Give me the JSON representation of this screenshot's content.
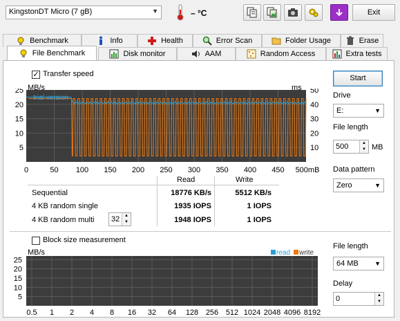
{
  "toolbar": {
    "drive": "KingstonDT Micro (7 gB)",
    "temperature": "– °C",
    "exit_label": "Exit",
    "icons": [
      "copy-text-icon",
      "copy-image-icon",
      "camera-icon",
      "options-gear-icon",
      "save-down-icon"
    ]
  },
  "tabs_top": [
    "Benchmark",
    "Info",
    "Health",
    "Error Scan",
    "Folder Usage",
    "Erase"
  ],
  "tabs_bottom": [
    "File Benchmark",
    "Disk monitor",
    "AAM",
    "Random Access",
    "Extra tests"
  ],
  "transfer": {
    "checkbox_label": "Transfer speed",
    "checked": true,
    "left_unit": "MB/s",
    "right_unit": "ms",
    "watermark": "trial version",
    "y_left": [
      "25",
      "20",
      "15",
      "10",
      "5"
    ],
    "y_right": [
      "50",
      "40",
      "30",
      "20",
      "10"
    ],
    "x_ticks": [
      "0",
      "50",
      "100",
      "150",
      "200",
      "250",
      "300",
      "350",
      "400",
      "450",
      "500mB"
    ]
  },
  "results": {
    "col_read": "Read",
    "col_write": "Write",
    "rows": [
      {
        "label": "Sequential",
        "read": "18776 KB/s",
        "write": "5512 KB/s"
      },
      {
        "label": "4 KB random single",
        "read": "1935 IOPS",
        "write": "1 IOPS"
      },
      {
        "label": "4 KB random multi",
        "read": "1948 IOPS",
        "write": "1 IOPS"
      }
    ],
    "queue_depth": "32"
  },
  "right_top": {
    "start_label": "Start",
    "drive_label": "Drive",
    "drive_value": "E:",
    "file_length_label": "File length",
    "file_length_value": "500",
    "file_length_unit": "MB",
    "pattern_label": "Data pattern",
    "pattern_value": "Zero"
  },
  "block": {
    "checkbox_label": "Block size measurement",
    "checked": false,
    "unit": "MB/s",
    "legend_read": "read",
    "legend_write": "write",
    "y_ticks": [
      "25",
      "20",
      "15",
      "10",
      "5"
    ],
    "x_ticks": [
      "0.5",
      "1",
      "2",
      "4",
      "8",
      "16",
      "32",
      "64",
      "128",
      "256",
      "512",
      "1024",
      "2048",
      "4096",
      "8192"
    ]
  },
  "right_bottom": {
    "file_length_label": "File length",
    "file_length_value": "64 MB",
    "delay_label": "Delay",
    "delay_value": "0"
  },
  "colors": {
    "read": "#2a9fd6",
    "write": "#ee7a12",
    "graph_bg": "#3c3c3c",
    "grid": "#5a5a5a"
  },
  "chart_data": [
    {
      "type": "line",
      "title": "",
      "xlabel": "",
      "ylabel": "MB/s",
      "xlim": [
        0,
        500
      ],
      "ylim": [
        0,
        25
      ],
      "y2label": "ms",
      "y2lim": [
        0,
        50
      ],
      "series": [
        {
          "name": "",
          "values": [
            22.5,
            22.5,
            22.5,
            22.5,
            22.5,
            20.5,
            20.5,
            20.5,
            20.5,
            20.5,
            20.5
          ]
        },
        {
          "name": "",
          "values": [
            22.5,
            22.5,
            22.5,
            22.5,
            22.5,
            6,
            6,
            6,
            6,
            6,
            6
          ]
        }
      ],
      "x": [
        0,
        50,
        80,
        81,
        85,
        90,
        150,
        250,
        350,
        450,
        500
      ],
      "write_band": [
        2,
        22
      ],
      "grid": true
    },
    {
      "type": "bar",
      "title": "",
      "ylabel": "MB/s",
      "ylim": [
        0,
        25
      ],
      "categories": [
        "0.5",
        "1",
        "2",
        "4",
        "8",
        "16",
        "32",
        "64",
        "128",
        "256",
        "512",
        "1024",
        "2048",
        "4096",
        "8192"
      ],
      "series": [
        {
          "name": "read",
          "values": []
        },
        {
          "name": "write",
          "values": []
        }
      ],
      "legend": "top-right",
      "grid": true
    }
  ]
}
